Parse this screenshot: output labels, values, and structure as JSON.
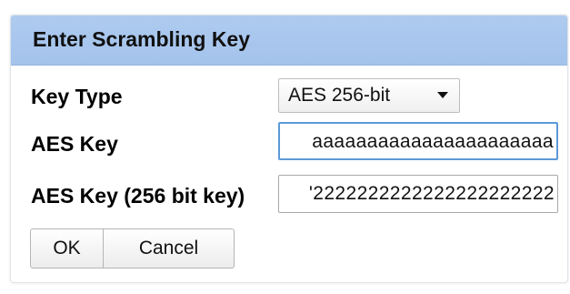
{
  "dialog": {
    "title": "Enter Scrambling Key"
  },
  "form": {
    "key_type": {
      "label": "Key Type",
      "selected": "AES 256-bit"
    },
    "aes_key": {
      "label": "AES Key",
      "value": "aaaaaaaaaaaaaaaaaaaaaa"
    },
    "aes_key_256": {
      "label": "AES Key (256 bit key)",
      "value": "'2222222222222222222222"
    }
  },
  "buttons": {
    "ok": "OK",
    "cancel": "Cancel"
  },
  "colors": {
    "titlebar": "#a9c7ee",
    "focus_border": "#5c9ad8"
  },
  "icons": {
    "select_caret": "chevron-down-icon"
  }
}
